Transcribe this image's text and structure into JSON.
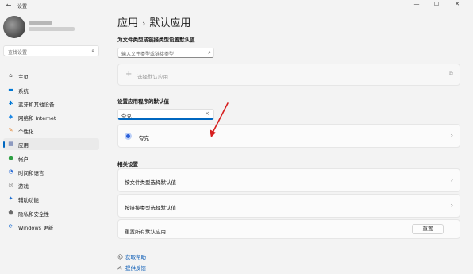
{
  "window": {
    "title": "设置",
    "controls": [
      "—",
      "☐",
      "✕"
    ]
  },
  "sidebar": {
    "search_placeholder": "查找设置",
    "items": [
      {
        "label": "主页",
        "icon": "home-icon",
        "glyph": "⌂",
        "color": "#555555"
      },
      {
        "label": "系统",
        "icon": "system-icon",
        "glyph": "▬",
        "color": "#0078d4"
      },
      {
        "label": "蓝牙和其他设备",
        "icon": "bluetooth-icon",
        "glyph": "✱",
        "color": "#0078d4"
      },
      {
        "label": "网络和 Internet",
        "icon": "network-icon",
        "glyph": "◆",
        "color": "#1e88e5"
      },
      {
        "label": "个性化",
        "icon": "personalization-icon",
        "glyph": "✎",
        "color": "#e07a1f"
      },
      {
        "label": "应用",
        "icon": "apps-icon",
        "glyph": "▦",
        "color": "#5a6ea8",
        "active": true
      },
      {
        "label": "帐户",
        "icon": "accounts-icon",
        "glyph": "●",
        "color": "#2ea043"
      },
      {
        "label": "时间和语言",
        "icon": "time-language-icon",
        "glyph": "◔",
        "color": "#2f6fd6"
      },
      {
        "label": "游戏",
        "icon": "gaming-icon",
        "glyph": "◎",
        "color": "#6b6b6b"
      },
      {
        "label": "辅助功能",
        "icon": "accessibility-icon",
        "glyph": "✦",
        "color": "#1f6fd0"
      },
      {
        "label": "隐私和安全性",
        "icon": "privacy-icon",
        "glyph": "⬟",
        "color": "#6b6b6b"
      },
      {
        "label": "Windows 更新",
        "icon": "windows-update-icon",
        "glyph": "⟳",
        "color": "#1f6fd0"
      }
    ]
  },
  "main": {
    "breadcrumb_parent": "应用",
    "breadcrumb_sep": "›",
    "breadcrumb_current": "默认应用",
    "filetype_heading": "为文件类型或链接类型设置默认值",
    "filetype_placeholder": "输入文件类型或链接类型",
    "choose_default_label": "选择默认应用",
    "apps_heading": "设置应用程序的默认值",
    "app_search_value": "夸克",
    "app_result": "夸克",
    "related_heading": "相关设置",
    "related_items": [
      "按文件类型选择默认值",
      "按链接类型选择默认值"
    ],
    "reset_label": "重置所有默认应用",
    "reset_button": "重置",
    "help_link": "获取帮助",
    "feedback_link": "提供反馈"
  }
}
